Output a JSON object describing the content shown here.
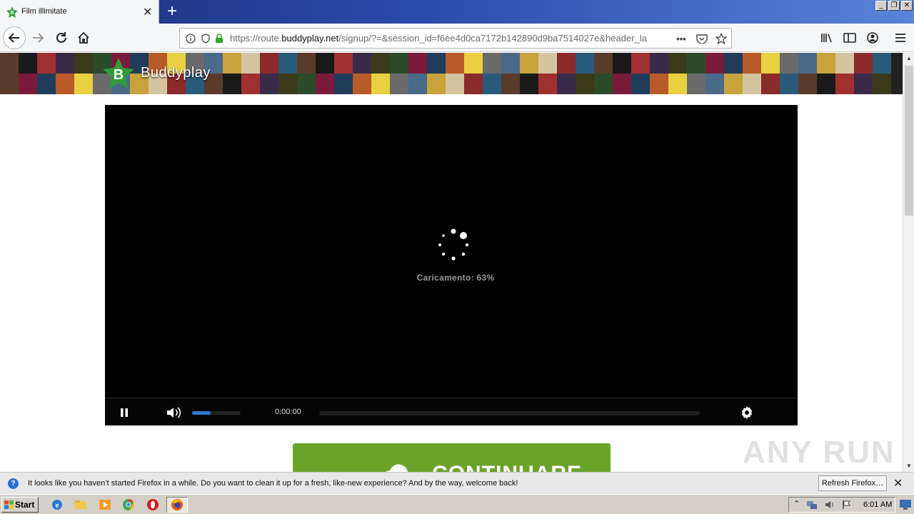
{
  "browser": {
    "tab_title": "Film illimitate",
    "url_prefix": "https://route.",
    "url_domain": "buddyplay.net",
    "url_rest": "/signup/?=&session_id=f6ee4d0ca7172b142890d9ba7514027e&header_la",
    "icons": [
      "back-icon",
      "forward-icon",
      "reload-icon",
      "home-icon",
      "info-icon",
      "shield-icon",
      "lock-icon",
      "more-icon",
      "pocket-icon",
      "bookmark-star-icon",
      "library-icon",
      "sidebar-icon",
      "account-icon",
      "menu-icon"
    ]
  },
  "site": {
    "brand": "Buddyplay",
    "logo_letter": "B",
    "accent": "#6aa32a"
  },
  "player": {
    "loading_text": "Caricamento: 63%",
    "time": "0:00:00",
    "volume_level": 0.38,
    "progress": 0
  },
  "cta": {
    "label": "CONTINUARE"
  },
  "watermark": "ANY RUN",
  "notification": {
    "message": "It looks like you haven’t started Firefox in a while. Do you want to clean it up for a fresh, like-new experience? And by the way, welcome back!",
    "button": "Refresh Firefox…"
  },
  "taskbar": {
    "start_label": "Start",
    "clock": "6:01 AM"
  }
}
